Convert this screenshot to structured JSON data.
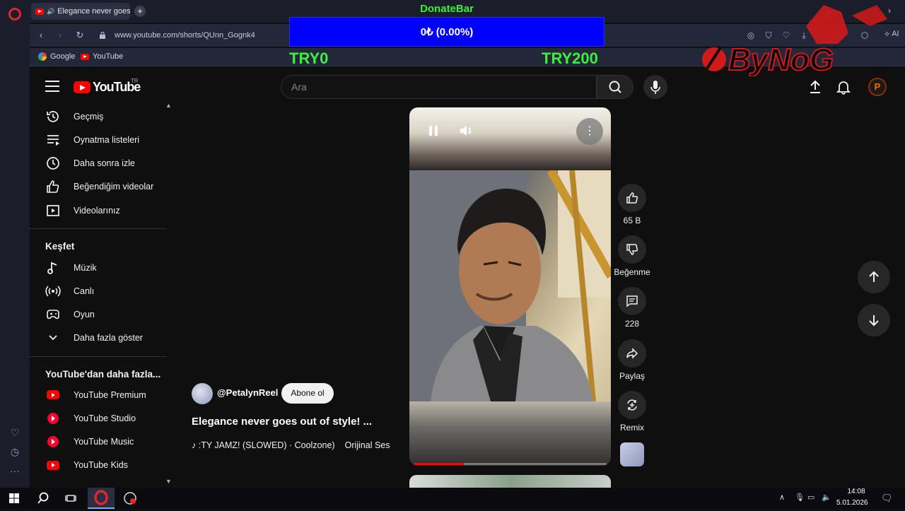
{
  "browser": {
    "tab_title": "Elegance never goes o",
    "new_tab_icon": "+",
    "url": "www.youtube.com/shorts/QUnn_Gognk4",
    "bookmarks": [
      {
        "label": "Google",
        "icon": "google-icon"
      },
      {
        "label": "YouTube",
        "icon": "youtube-icon"
      }
    ],
    "ai_label": "AI"
  },
  "donate_overlay": {
    "title": "DonateBar",
    "progress_text": "0₺ (0.00%)",
    "progress_fraction": 0.0,
    "min_label": "TRY0",
    "max_label": "TRY200",
    "bar_color": "#0000ff",
    "text_color": "#3ef03e"
  },
  "watermark": {
    "text": "ByNoG",
    "accent": "#d11a1a"
  },
  "youtube": {
    "logo_text": "YouTube",
    "region": "TR",
    "search_placeholder": "Ara",
    "avatar_letter": "P"
  },
  "sidebar": {
    "you_items": [
      {
        "label": "Geçmiş",
        "icon": "history-icon"
      },
      {
        "label": "Oynatma listeleri",
        "icon": "playlists-icon"
      },
      {
        "label": "Daha sonra izle",
        "icon": "watch-later-icon"
      },
      {
        "label": "Beğendiğim videolar",
        "icon": "liked-icon"
      },
      {
        "label": "Videolarınız",
        "icon": "your-videos-icon"
      }
    ],
    "explore_heading": "Keşfet",
    "explore_items": [
      {
        "label": "Müzik",
        "icon": "music-icon"
      },
      {
        "label": "Canlı",
        "icon": "live-icon"
      },
      {
        "label": "Oyun",
        "icon": "gaming-icon"
      },
      {
        "label": "Daha fazla göster",
        "icon": "chevron-down-icon"
      }
    ],
    "more_heading": "YouTube'dan daha fazla...",
    "more_items": [
      {
        "label": "YouTube Premium",
        "icon": "youtube-premium-icon"
      },
      {
        "label": "YouTube Studio",
        "icon": "youtube-studio-icon"
      },
      {
        "label": "YouTube Music",
        "icon": "youtube-music-icon"
      },
      {
        "label": "YouTube Kids",
        "icon": "youtube-kids-icon"
      }
    ]
  },
  "short": {
    "channel": "@PetalynReel",
    "subscribe_label": "Abone ol",
    "title": "Elegance never goes out of style! ...",
    "sound_track": "♪ :TY JAMZ! (SLOWED) · Coolzone)",
    "sound_original": "Orijinal Ses",
    "progress_fraction": 0.26,
    "actions": {
      "like_count": "65 B",
      "dislike_label": "Beğenme",
      "comment_count": "228",
      "share_label": "Paylaş",
      "remix_label": "Remix"
    }
  },
  "taskbar": {
    "time": "14:08",
    "date": "5.01.2026"
  }
}
